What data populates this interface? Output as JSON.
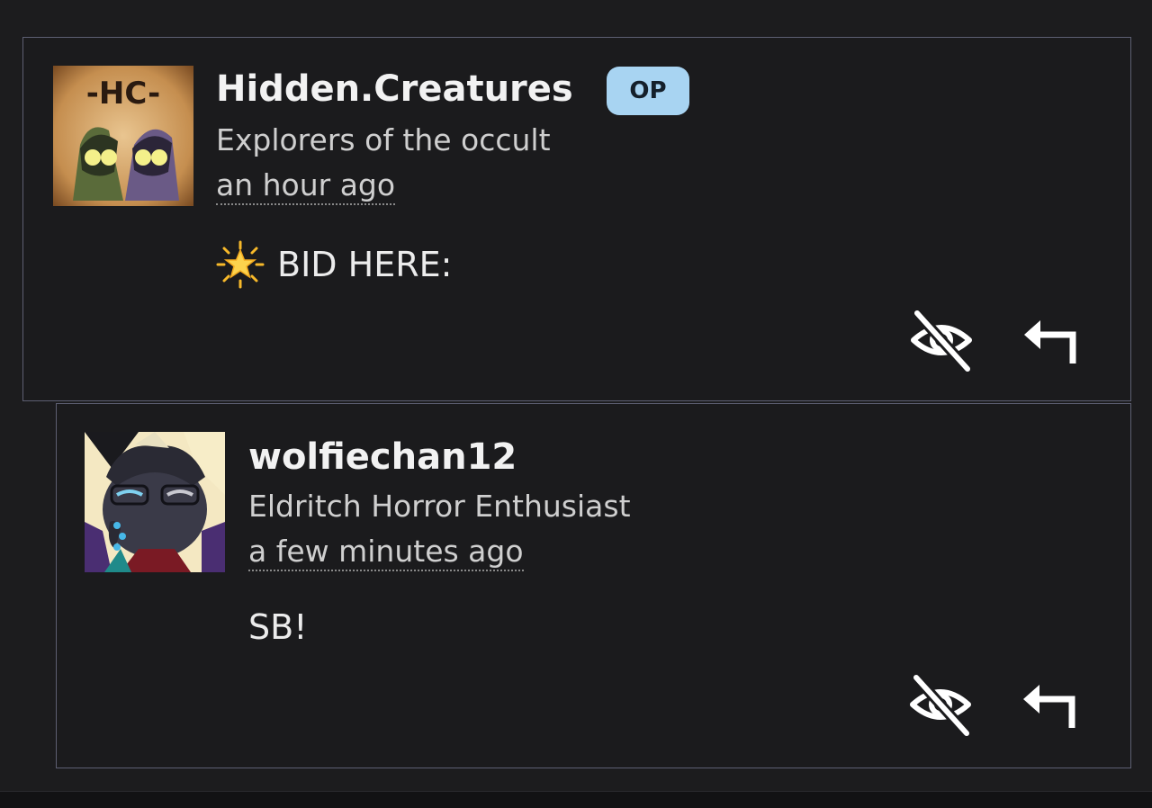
{
  "comments": [
    {
      "username": "Hidden.Creatures",
      "badge": "OP",
      "subtitle": "Explorers of the occult",
      "time": "an hour ago",
      "body": "BID HERE:",
      "avatar_text": "-HC-"
    },
    {
      "username": "wolfiechan12",
      "subtitle": "Eldritch Horror Enthusiast",
      "time": "a few minutes ago",
      "body": "SB!"
    }
  ],
  "icons": {
    "hide": "eye-off-icon",
    "reply": "reply-arrow-icon",
    "star": "glowing-star-icon"
  },
  "colors": {
    "background": "#1c1c1e",
    "border": "#5d5f72",
    "badge": "#a8d4f2"
  }
}
